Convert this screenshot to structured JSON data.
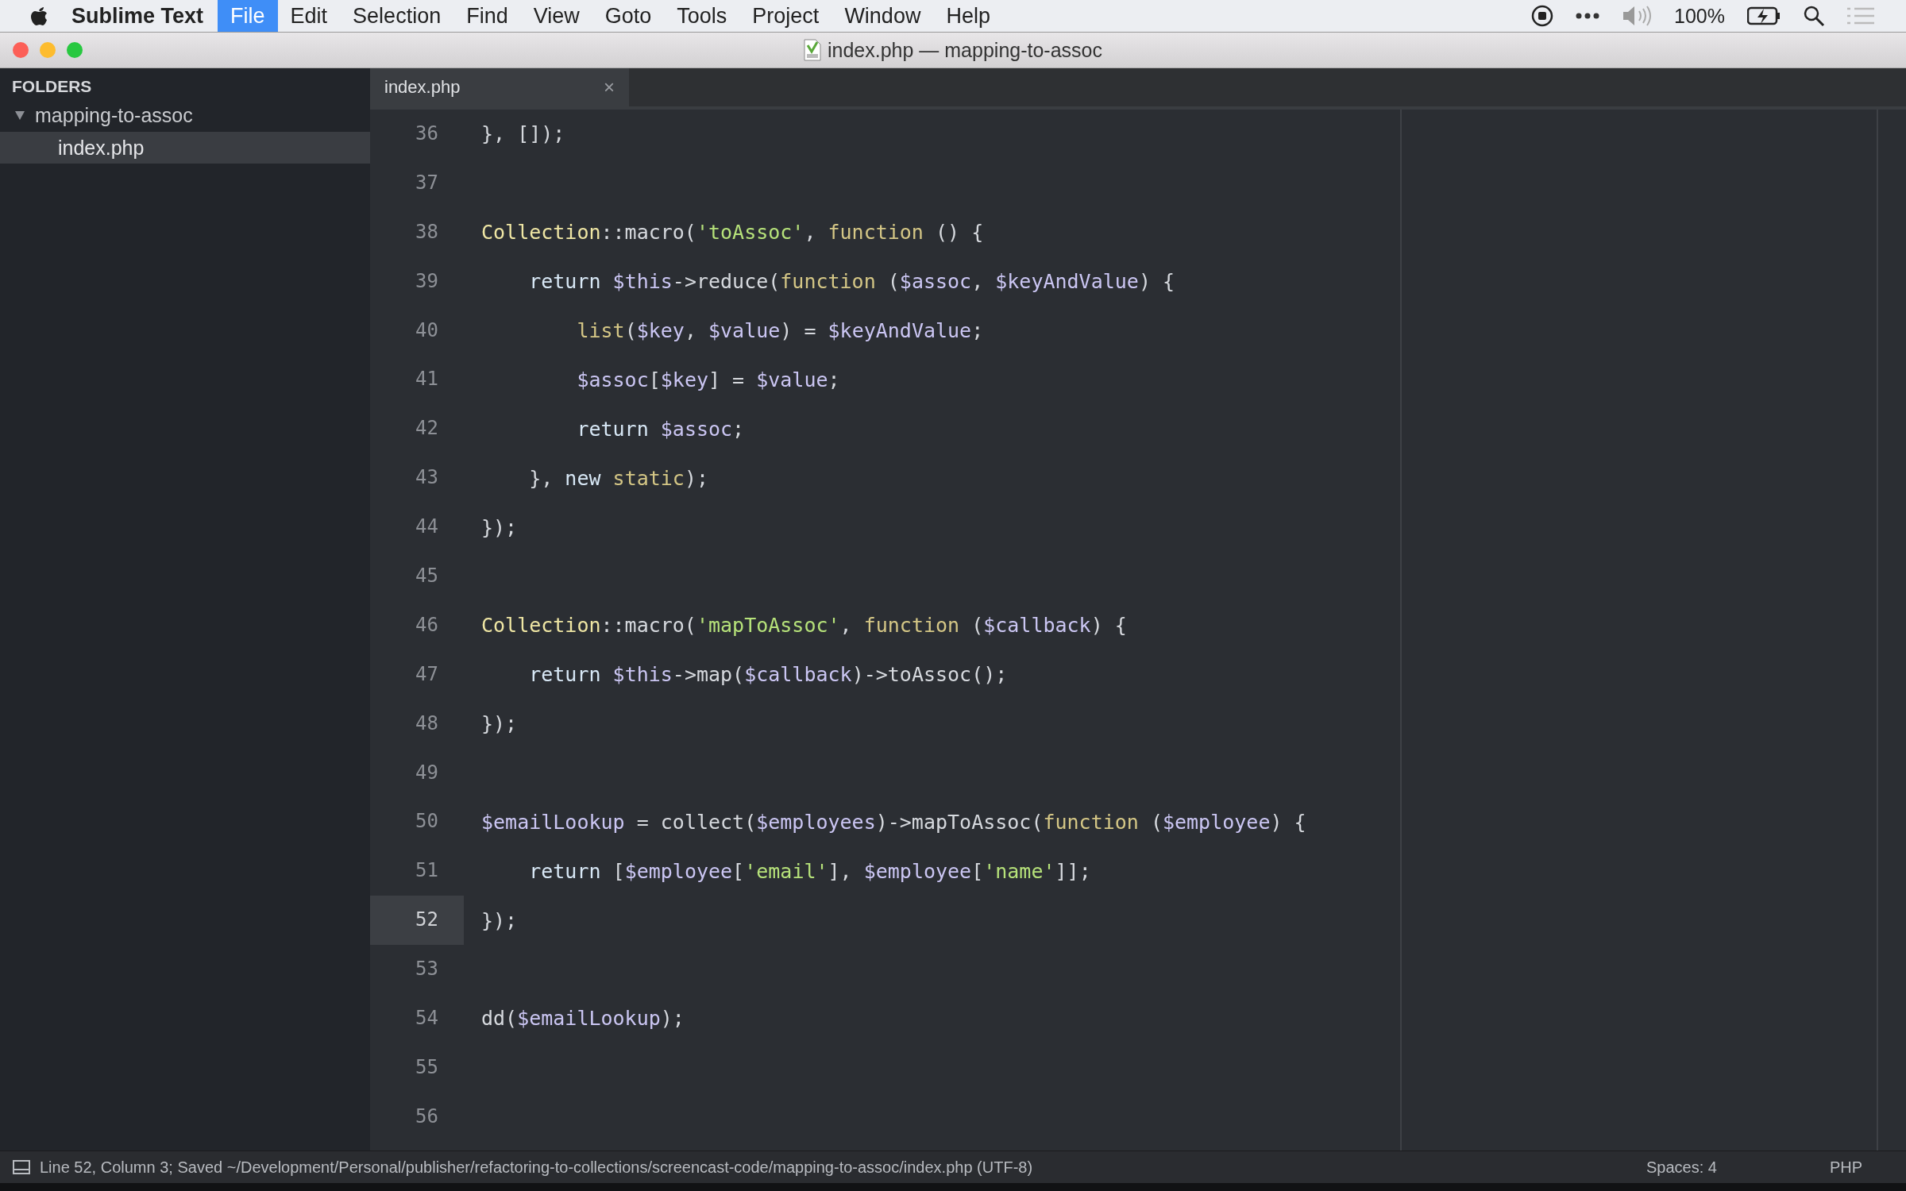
{
  "menu_bar": {
    "app_name": "Sublime Text",
    "items": [
      {
        "label": "File",
        "selected": true
      },
      {
        "label": "Edit",
        "selected": false
      },
      {
        "label": "Selection",
        "selected": false
      },
      {
        "label": "Find",
        "selected": false
      },
      {
        "label": "View",
        "selected": false
      },
      {
        "label": "Goto",
        "selected": false
      },
      {
        "label": "Tools",
        "selected": false
      },
      {
        "label": "Project",
        "selected": false
      },
      {
        "label": "Window",
        "selected": false
      },
      {
        "label": "Help",
        "selected": false
      }
    ],
    "battery": "100%"
  },
  "window": {
    "title": "index.php — mapping-to-assoc"
  },
  "sidebar": {
    "heading": "FOLDERS",
    "folders": [
      {
        "label": "mapping-to-assoc",
        "expanded": true,
        "children": [
          {
            "label": "index.php",
            "selected": true
          }
        ]
      }
    ]
  },
  "tabs": [
    {
      "label": "index.php",
      "selected": true,
      "close": "×"
    }
  ],
  "editor": {
    "lines": [
      {
        "number": "36",
        "current": false,
        "tokens": [
          {
            "kind": "plain",
            "text": "}, []);"
          }
        ]
      },
      {
        "number": "37",
        "current": false
      },
      {
        "number": "38",
        "current": false,
        "tokens": [
          {
            "kind": "cls",
            "text": "Collection"
          },
          {
            "kind": "plain",
            "text": "::macro("
          },
          {
            "kind": "str",
            "text": "'toAssoc'"
          },
          {
            "kind": "plain",
            "text": ", "
          },
          {
            "kind": "fn",
            "text": "function"
          },
          {
            "kind": "plain",
            "text": " () {"
          }
        ]
      },
      {
        "number": "39",
        "current": false,
        "tokens": [
          {
            "kind": "kw",
            "text": "    return "
          },
          {
            "kind": "var",
            "text": "$this"
          },
          {
            "kind": "plain",
            "text": "->reduce("
          },
          {
            "kind": "fn",
            "text": "function"
          },
          {
            "kind": "plain",
            "text": " ("
          },
          {
            "kind": "var",
            "text": "$assoc"
          },
          {
            "kind": "plain",
            "text": ", "
          },
          {
            "kind": "var",
            "text": "$keyAndValue"
          },
          {
            "kind": "plain",
            "text": ") {"
          }
        ]
      },
      {
        "number": "40",
        "current": false,
        "tokens": [
          {
            "kind": "fn",
            "text": "        list"
          },
          {
            "kind": "plain",
            "text": "("
          },
          {
            "kind": "var",
            "text": "$key"
          },
          {
            "kind": "plain",
            "text": ", "
          },
          {
            "kind": "var",
            "text": "$value"
          },
          {
            "kind": "plain",
            "text": ") = "
          },
          {
            "kind": "var",
            "text": "$keyAndValue"
          },
          {
            "kind": "plain",
            "text": ";"
          }
        ]
      },
      {
        "number": "41",
        "current": false,
        "tokens": [
          {
            "kind": "var",
            "text": "        $assoc"
          },
          {
            "kind": "plain",
            "text": "["
          },
          {
            "kind": "var",
            "text": "$key"
          },
          {
            "kind": "plain",
            "text": "] = "
          },
          {
            "kind": "var",
            "text": "$value"
          },
          {
            "kind": "plain",
            "text": ";"
          }
        ]
      },
      {
        "number": "42",
        "current": false,
        "tokens": [
          {
            "kind": "kw",
            "text": "        return "
          },
          {
            "kind": "var",
            "text": "$assoc"
          },
          {
            "kind": "plain",
            "text": ";"
          }
        ]
      },
      {
        "number": "43",
        "current": false,
        "tokens": [
          {
            "kind": "plain",
            "text": "    }, "
          },
          {
            "kind": "kw",
            "text": "new "
          },
          {
            "kind": "fn",
            "text": "static"
          },
          {
            "kind": "plain",
            "text": ");"
          }
        ]
      },
      {
        "number": "44",
        "current": false,
        "tokens": [
          {
            "kind": "plain",
            "text": "});"
          }
        ]
      },
      {
        "number": "45",
        "current": false
      },
      {
        "number": "46",
        "current": false,
        "tokens": [
          {
            "kind": "cls",
            "text": "Collection"
          },
          {
            "kind": "plain",
            "text": "::macro("
          },
          {
            "kind": "str",
            "text": "'mapToAssoc'"
          },
          {
            "kind": "plain",
            "text": ", "
          },
          {
            "kind": "fn",
            "text": "function"
          },
          {
            "kind": "plain",
            "text": " ("
          },
          {
            "kind": "var",
            "text": "$callback"
          },
          {
            "kind": "plain",
            "text": ") {"
          }
        ]
      },
      {
        "number": "47",
        "current": false,
        "tokens": [
          {
            "kind": "kw",
            "text": "    return "
          },
          {
            "kind": "var",
            "text": "$this"
          },
          {
            "kind": "plain",
            "text": "->map("
          },
          {
            "kind": "var",
            "text": "$callback"
          },
          {
            "kind": "plain",
            "text": ")->toAssoc();"
          }
        ]
      },
      {
        "number": "48",
        "current": false,
        "tokens": [
          {
            "kind": "plain",
            "text": "});"
          }
        ]
      },
      {
        "number": "49",
        "current": false
      },
      {
        "number": "50",
        "current": false,
        "tokens": [
          {
            "kind": "var",
            "text": "$emailLookup"
          },
          {
            "kind": "plain",
            "text": " = collect("
          },
          {
            "kind": "var",
            "text": "$employees"
          },
          {
            "kind": "plain",
            "text": ")->mapToAssoc("
          },
          {
            "kind": "fn",
            "text": "function"
          },
          {
            "kind": "plain",
            "text": " ("
          },
          {
            "kind": "var",
            "text": "$employee"
          },
          {
            "kind": "plain",
            "text": ") {"
          }
        ]
      },
      {
        "number": "51",
        "current": false,
        "tokens": [
          {
            "kind": "kw",
            "text": "    return "
          },
          {
            "kind": "plain",
            "text": "["
          },
          {
            "kind": "var",
            "text": "$employee"
          },
          {
            "kind": "plain",
            "text": "["
          },
          {
            "kind": "str",
            "text": "'email'"
          },
          {
            "kind": "plain",
            "text": "], "
          },
          {
            "kind": "var",
            "text": "$employee"
          },
          {
            "kind": "plain",
            "text": "["
          },
          {
            "kind": "str",
            "text": "'name'"
          },
          {
            "kind": "plain",
            "text": "]];"
          }
        ]
      },
      {
        "number": "52",
        "current": true,
        "tokens": [
          {
            "kind": "plain",
            "text": "});"
          }
        ]
      },
      {
        "number": "53",
        "current": false
      },
      {
        "number": "54",
        "current": false,
        "tokens": [
          {
            "kind": "plain",
            "text": "dd("
          },
          {
            "kind": "var",
            "text": "$emailLookup"
          },
          {
            "kind": "plain",
            "text": ");"
          }
        ]
      },
      {
        "number": "55",
        "current": false
      },
      {
        "number": "56",
        "current": false
      }
    ]
  },
  "status_bar": {
    "message": "Line 52, Column 3; Saved ~/Development/Personal/publisher/refactoring-to-collections/screencast-code/mapping-to-assoc/index.php (UTF-8)",
    "indentation": "Spaces: 4",
    "syntax": "PHP"
  }
}
